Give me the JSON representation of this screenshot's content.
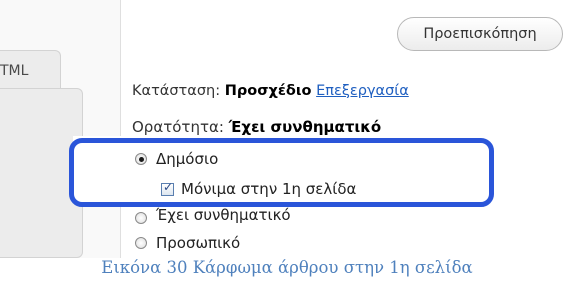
{
  "editor": {
    "html_tab_label": "TML"
  },
  "publish_box": {
    "preview_button": "Προεπισκόπηση",
    "status_label": "Κατάσταση:",
    "status_value": "Προσχέδιο",
    "status_edit_link": "Επεξεργασία",
    "visibility_label": "Ορατότητα:",
    "visibility_value": "Έχει συνθηματικό",
    "options": {
      "public": "Δημόσιο",
      "sticky": "Μόνιμα στην 1η σελίδα",
      "password": "Έχει συνθηματικό",
      "private": "Προσωπικό"
    },
    "selected_option": "public",
    "sticky_checked": true
  },
  "caption": "Εικόνα 30 Κάρφωμα άρθρου στην 1η σελίδα",
  "colors": {
    "highlight": "#2a55d9",
    "link": "#1f5fc0",
    "caption": "#4f81bd"
  }
}
